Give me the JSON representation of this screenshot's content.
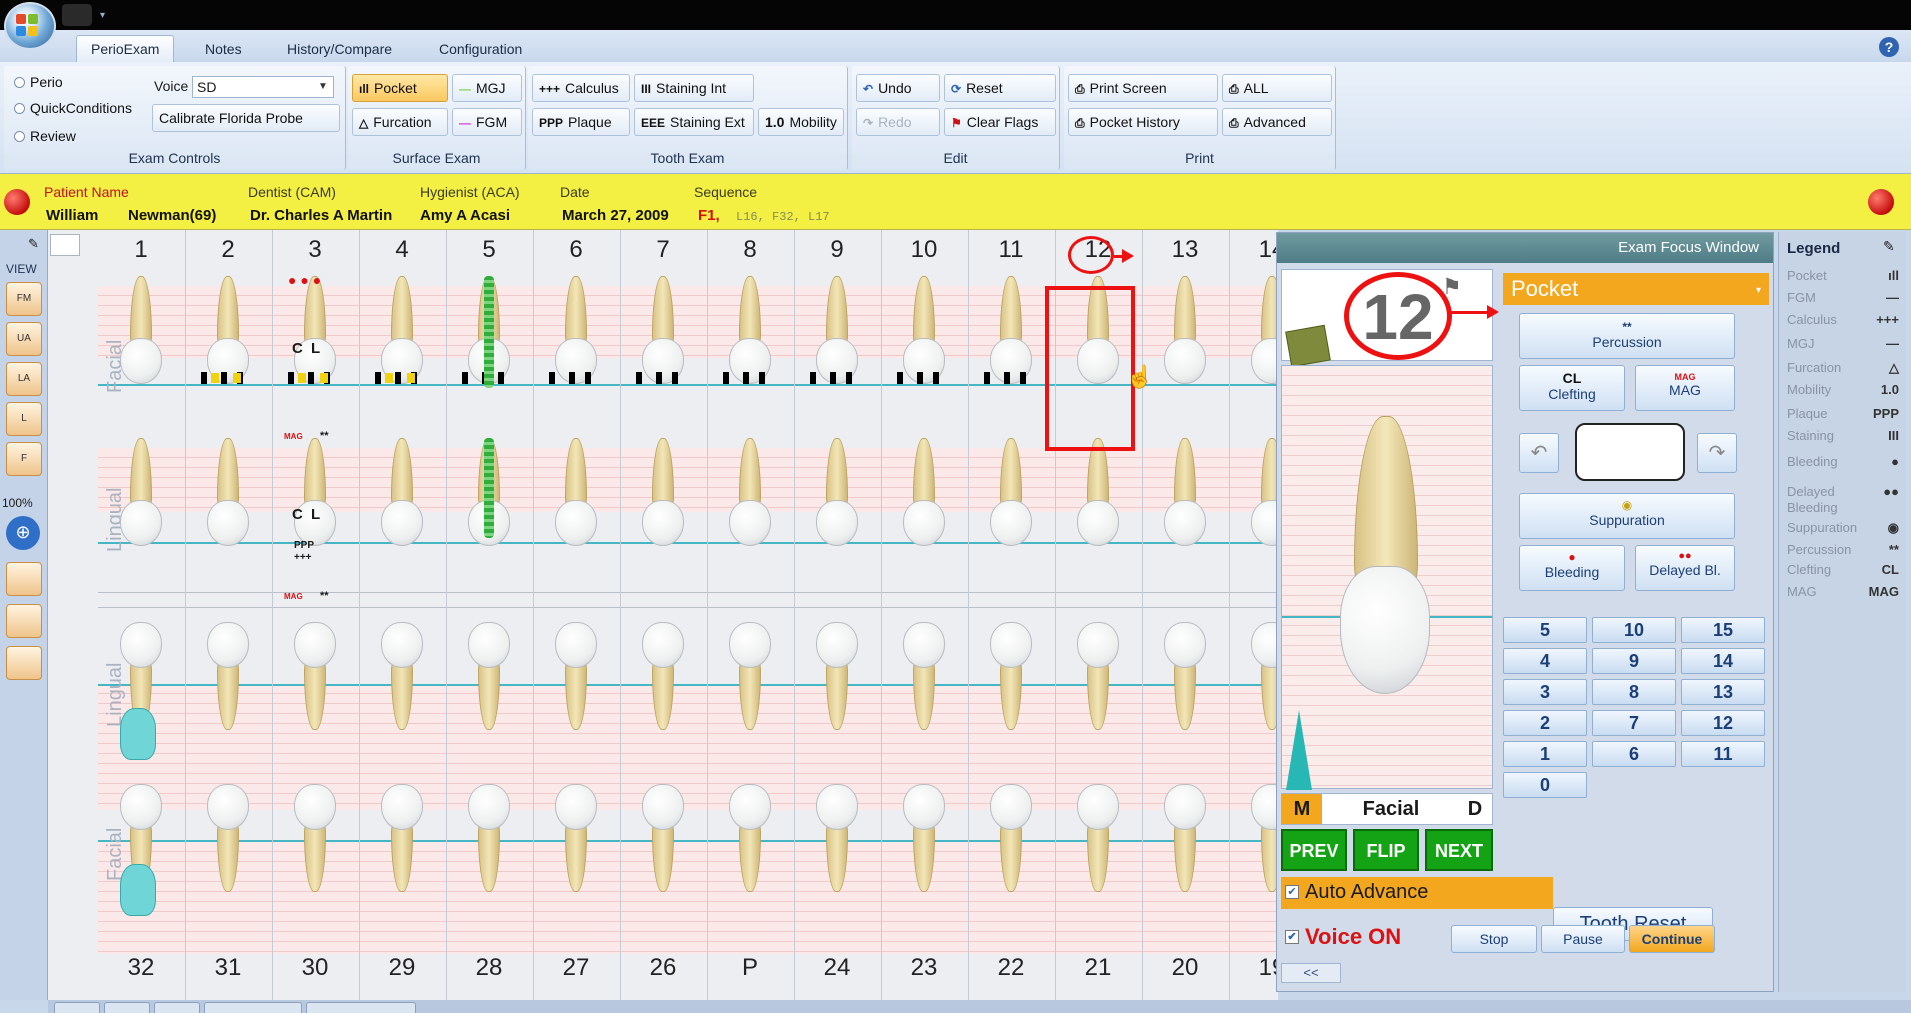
{
  "ribbon": {
    "tabs": [
      "PerioExam",
      "Notes",
      "History/Compare",
      "Configuration"
    ],
    "active_tab": "PerioExam",
    "exam_controls": {
      "modes": [
        "Perio",
        "QuickConditions",
        "Review"
      ],
      "voice_label": "Voice",
      "voice_value": "SD",
      "calibrate_label": "Calibrate Florida Probe",
      "group_label": "Exam Controls"
    },
    "surface_exam": {
      "pocket": "Pocket",
      "mgj": "MGJ",
      "furcation": "Furcation",
      "fgm": "FGM",
      "group_label": "Surface Exam"
    },
    "tooth_exam": {
      "calculus": "Calculus",
      "staining_int": "Staining Int",
      "plaque": "Plaque",
      "staining_ext": "Staining Ext",
      "mobility_icon": "1.0",
      "mobility": "Mobility",
      "group_label": "Tooth Exam"
    },
    "edit": {
      "undo": "Undo",
      "reset": "Reset",
      "redo": "Redo",
      "clear_flags": "Clear Flags",
      "group_label": "Edit"
    },
    "print": {
      "print_screen": "Print Screen",
      "all": "ALL",
      "pocket_history": "Pocket History",
      "advanced": "Advanced",
      "group_label": "Print"
    }
  },
  "patient": {
    "labels": {
      "name": "Patient Name",
      "dentist": "Dentist (CAM)",
      "hygienist": "Hygienist (ACA)",
      "date": "Date",
      "sequence": "Sequence"
    },
    "first_name": "William",
    "last_name": "Newman(69)",
    "dentist": "Dr. Charles A Martin",
    "hygienist": "Amy A Acasi",
    "date": "March 27, 2009",
    "sequence_active": "F1,",
    "sequence_rest": "L16,  F32,  L17"
  },
  "viewbar": {
    "label": "VIEW",
    "zoom": "100%",
    "buttons": [
      "FM",
      "UA",
      "LA",
      "L",
      "F"
    ]
  },
  "chart": {
    "upper_numbers": [
      "1",
      "2",
      "3",
      "4",
      "5",
      "6",
      "7",
      "8",
      "9",
      "10",
      "11",
      "12",
      "13",
      "14"
    ],
    "lower_numbers": [
      "32",
      "31",
      "30",
      "29",
      "28",
      "27",
      "26",
      "P",
      "24",
      "23",
      "22",
      "21",
      "20",
      "19"
    ],
    "side_labels": {
      "facial_top": "Facial",
      "lingual_top": "Lingual",
      "lingual_bottom": "Lingual",
      "facial_bottom": "Facial"
    },
    "tooth3_facial": "C L",
    "tooth3_lingual": "C L",
    "tooth3_plaque": "PPP",
    "tooth3_calculus": "+++",
    "mag_text": "MAG",
    "perc_text": "**"
  },
  "focus": {
    "title": "Exam Focus Window",
    "tooth_number": "12",
    "mode": "Pocket",
    "percussion_icon": "**",
    "percussion": "Percussion",
    "clefting_icon": "CL",
    "clefting": "Clefting",
    "mag_icon": "MAG",
    "mag": "MAG",
    "suppuration": "Suppuration",
    "bleeding": "Bleeding",
    "delayed_bl": "Delayed Bl.",
    "numbers": [
      [
        "5",
        "10",
        "15"
      ],
      [
        "4",
        "9",
        "14"
      ],
      [
        "3",
        "8",
        "13"
      ],
      [
        "2",
        "7",
        "12"
      ],
      [
        "1",
        "6",
        "11"
      ],
      [
        "0"
      ]
    ],
    "m": "M",
    "surface": "Facial",
    "d": "D",
    "prev": "PREV",
    "flip": "FLIP",
    "next": "NEXT",
    "tooth_reset": "Tooth Reset",
    "auto_advance": "Auto Advance",
    "voice_on": "Voice ON",
    "stop": "Stop",
    "pause": "Pause",
    "continue": "Continue",
    "collapse": "<<"
  },
  "legend": {
    "title": "Legend",
    "items": [
      {
        "label": "Pocket",
        "symbol": "ıll"
      },
      {
        "label": "FGM",
        "symbol": "—"
      },
      {
        "label": "Calculus",
        "symbol": "+++"
      },
      {
        "label": "MGJ",
        "symbol": "—"
      },
      {
        "label": "Furcation",
        "symbol": "△"
      },
      {
        "label": "Mobility",
        "symbol": "1.0"
      },
      {
        "label": "Plaque",
        "symbol": "PPP"
      },
      {
        "label": "Staining",
        "symbol": "III"
      },
      {
        "label": "Bleeding",
        "symbol": "●"
      },
      {
        "label": "Delayed Bleeding",
        "symbol": "●●"
      },
      {
        "label": "Suppuration",
        "symbol": "◉"
      },
      {
        "label": "Percussion",
        "symbol": "**"
      },
      {
        "label": "Clefting",
        "symbol": "CL"
      },
      {
        "label": "MAG",
        "symbol": "MAG"
      }
    ]
  },
  "colors": {
    "accent_orange": "#f2a71e",
    "patient_bar": "#f3ef43",
    "green": "#14a314",
    "red": "#e11111"
  }
}
